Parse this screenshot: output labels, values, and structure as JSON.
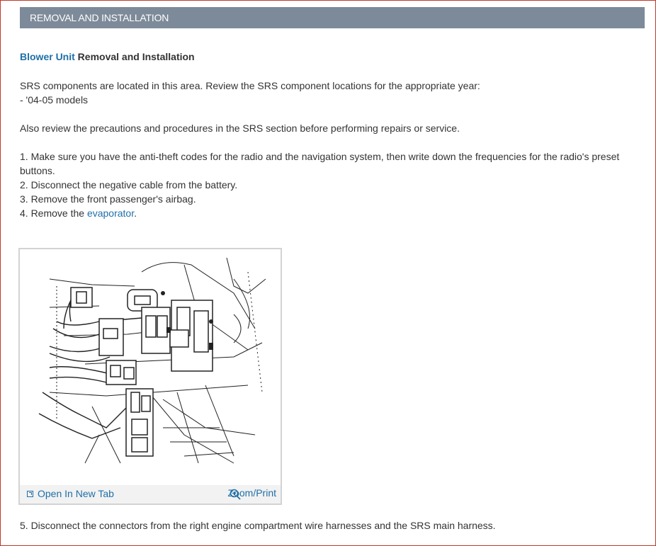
{
  "header": {
    "title": "REMOVAL AND INSTALLATION"
  },
  "section": {
    "title_link": "Blower Unit",
    "title_rest": " Removal and Installation"
  },
  "intro": {
    "srs_line": "SRS components are located in this area. Review the SRS component locations for the appropriate year:",
    "models_line": " -  '04-05 models",
    "precautions": "Also review the precautions and procedures in the SRS section before performing repairs or service."
  },
  "steps": [
    {
      "text": " 1. Make sure you have the anti-theft codes for the radio and the navigation system, then write down the frequencies for the radio's preset buttons."
    },
    {
      "text": " 2. Disconnect the negative cable from the battery."
    },
    {
      "text": " 3. Remove the front passenger's airbag."
    },
    {
      "prefix": " 4. Remove the ",
      "link": "evaporator",
      "suffix": "."
    },
    {
      "text": " 5. Disconnect the connectors from the right engine compartment wire harnesses and the SRS main harness."
    }
  ],
  "figure": {
    "open_tab_label": "Open In New Tab",
    "zoom_label": "Zoom/Print",
    "open_tab_icon": "open-new-tab-icon",
    "zoom_icon": "zoom-magnifier-icon"
  },
  "colors": {
    "header_bg": "#7d8a99",
    "link": "#1f6fa8",
    "frame_border": "#c0392b"
  }
}
